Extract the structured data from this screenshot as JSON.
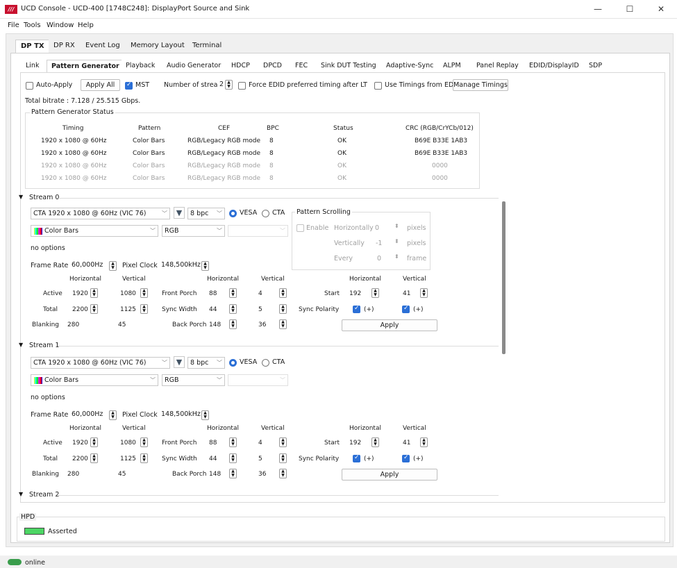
{
  "window": {
    "title": "UCD Console - UCD-400 [1748C248]: DisplayPort Source and Sink",
    "logo": "///",
    "minimize": "—",
    "maximize": "☐",
    "close": "✕"
  },
  "menu": [
    "File",
    "Tools",
    "Window",
    "Help"
  ],
  "main_tabs": [
    "DP TX",
    "DP RX",
    "Event Log",
    "Memory Layout",
    "Terminal"
  ],
  "sub_tabs": [
    "Link",
    "Pattern Generator",
    "Playback",
    "Audio Generator",
    "HDCP",
    "DPCD",
    "FEC",
    "Sink DUT Testing",
    "Adaptive-Sync",
    "ALPM",
    "Panel Replay",
    "EDID/DisplayID",
    "SDP"
  ],
  "toolbar": {
    "auto_apply": "Auto-Apply",
    "apply_all": "Apply All",
    "mst": "MST",
    "num_streams_label": "Number of streams",
    "num_streams": "2",
    "force_edid": "Force EDID preferred timing after LT",
    "use_timings": "Use Timings from EDID",
    "manage_timings": "Manage Timings"
  },
  "total_bitrate": "Total bitrate : 7.128 / 25.515 Gbps.",
  "status": {
    "title": "Pattern Generator Status",
    "headers": [
      "Timing",
      "Pattern",
      "CEF",
      "BPC",
      "Status",
      "CRC (RGB/CrYCb/012)"
    ],
    "rows": [
      [
        "1920 x 1080 @ 60Hz",
        "Color Bars",
        "RGB/Legacy RGB mode",
        "8",
        "OK",
        "B69E B33E 1AB3"
      ],
      [
        "1920 x 1080 @ 60Hz",
        "Color Bars",
        "RGB/Legacy RGB mode",
        "8",
        "OK",
        "B69E B33E 1AB3"
      ],
      [
        "1920 x 1080 @ 60Hz",
        "Color Bars",
        "RGB/Legacy RGB mode",
        "8",
        "OK",
        "0000"
      ],
      [
        "1920 x 1080 @ 60Hz",
        "Color Bars",
        "RGB/Legacy RGB mode",
        "8",
        "OK",
        "0000"
      ]
    ]
  },
  "stream0": {
    "title": "Stream 0",
    "timing": "CTA 1920 x 1080 @ 60Hz (VIC 76)",
    "bpc": "8 bpc",
    "vesa": "VESA",
    "cta": "CTA",
    "pattern": "Color Bars",
    "colorspace": "RGB",
    "options": "no options",
    "frame_rate_label": "Frame Rate",
    "frame_rate": "60,000Hz",
    "pixel_clock_label": "Pixel Clock",
    "pixel_clock": "148,500kHz",
    "scroll": {
      "title": "Pattern Scrolling",
      "enable": "Enable",
      "horiz_label": "Horizontally",
      "horiz": "0",
      "vert_label": "Vertically",
      "vert": "-1",
      "every_label": "Every",
      "every": "0",
      "pixels": "pixels",
      "frame": "frame"
    }
  },
  "stream1": {
    "title": "Stream 1",
    "timing": "CTA 1920 x 1080 @ 60Hz (VIC 76)",
    "bpc": "8 bpc",
    "vesa": "VESA",
    "cta": "CTA",
    "pattern": "Color Bars",
    "colorspace": "RGB",
    "options": "no options",
    "frame_rate_label": "Frame Rate",
    "frame_rate": "60,000Hz",
    "pixel_clock_label": "Pixel Clock",
    "pixel_clock": "148,500kHz"
  },
  "stream2": {
    "title": "Stream 2"
  },
  "timing_grid": {
    "h_label": "Horizontal",
    "v_label": "Vertical",
    "active": "Active",
    "total": "Total",
    "blanking": "Blanking",
    "active_h": "1920",
    "active_v": "1080",
    "total_h": "2200",
    "total_v": "1125",
    "blank_h": "280",
    "blank_v": "45",
    "front_porch": "Front Porch",
    "sync_width": "Sync Width",
    "back_porch": "Back Porch",
    "fp_h": "88",
    "fp_v": "4",
    "sw_h": "44",
    "sw_v": "5",
    "bp_h": "148",
    "bp_v": "36",
    "start": "Start",
    "start_h": "192",
    "start_v": "41",
    "sync_polarity": "Sync Polarity",
    "pol_h": "(+)",
    "pol_v": "(+)",
    "apply": "Apply"
  },
  "hpd": {
    "title": "HPD",
    "state": "Asserted"
  },
  "statusbar": {
    "text": "online"
  },
  "colors": {
    "accent": "#2b6fd6",
    "led_green": "#4cd664",
    "logo_red": "#c8102e"
  }
}
